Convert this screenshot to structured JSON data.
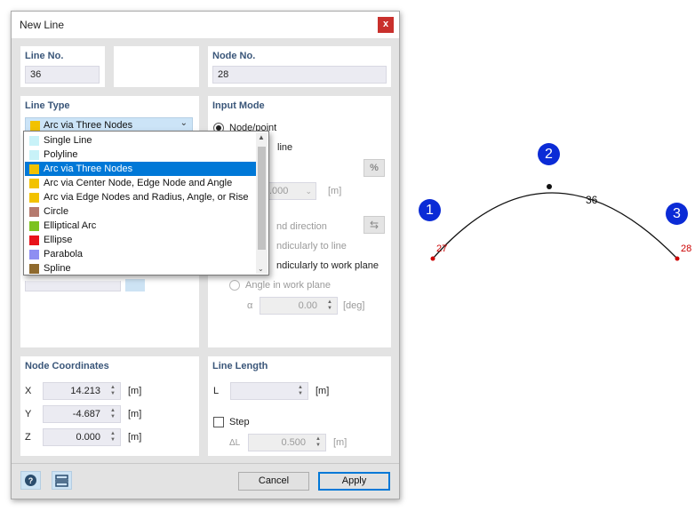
{
  "dialog": {
    "title": "New Line",
    "close_label": "x"
  },
  "line_no": {
    "title": "Line No.",
    "value": "36"
  },
  "node_no": {
    "title": "Node No.",
    "value": "28"
  },
  "line_type": {
    "title": "Line Type",
    "selected": "Arc via Three Nodes",
    "selected_color": "#f2c200",
    "options": [
      {
        "label": "Single Line",
        "color": "#c8f2f8"
      },
      {
        "label": "Polyline",
        "color": "#c8f2f8"
      },
      {
        "label": "Arc via Three Nodes",
        "color": "#f2c200"
      },
      {
        "label": "Arc via Center Node, Edge Node and Angle",
        "color": "#f2c200"
      },
      {
        "label": "Arc via Edge Nodes and Radius, Angle, or Rise",
        "color": "#f2c200"
      },
      {
        "label": "Circle",
        "color": "#b57a6e"
      },
      {
        "label": "Elliptical Arc",
        "color": "#7cc221"
      },
      {
        "label": "Ellipse",
        "color": "#e8131b"
      },
      {
        "label": "Parabola",
        "color": "#8e8ef2"
      },
      {
        "label": "Spline",
        "color": "#8f6a2e"
      }
    ]
  },
  "input_mode": {
    "title": "Input Mode",
    "node_point": "Node/point",
    "line_partial": "line",
    "length_value": ".000",
    "length_unit": "[m]",
    "percent_icon": "%",
    "direction_partial": "nd direction",
    "perp_line_partial": "ndicularly to line",
    "perp_plane_partial": "ndicularly to work plane",
    "angle_work_plane": "Angle in work plane",
    "alpha_label": "α",
    "alpha_value": "0.00",
    "alpha_unit": "[deg]"
  },
  "node_coordinates": {
    "title": "Node Coordinates",
    "x_label": "X",
    "x_value": "14.213",
    "x_unit": "[m]",
    "y_label": "Y",
    "y_value": "-4.687",
    "y_unit": "[m]",
    "z_label": "Z",
    "z_value": "0.000",
    "z_unit": "[m]"
  },
  "line_length": {
    "title": "Line Length",
    "l_label": "L",
    "l_value": "",
    "l_unit": "[m]",
    "step_label": "Step",
    "delta_label": "ΔL",
    "delta_value": "0.500",
    "delta_unit": "[m]"
  },
  "footer": {
    "cancel_label": "Cancel",
    "apply_label": "Apply"
  },
  "drawing": {
    "line_label": "36",
    "node_left_label": "27",
    "node_right_label": "28",
    "point_badges": [
      "1",
      "2",
      "3"
    ],
    "badge_color": "#0b2bd6",
    "node_label_color": "#cc0000"
  }
}
